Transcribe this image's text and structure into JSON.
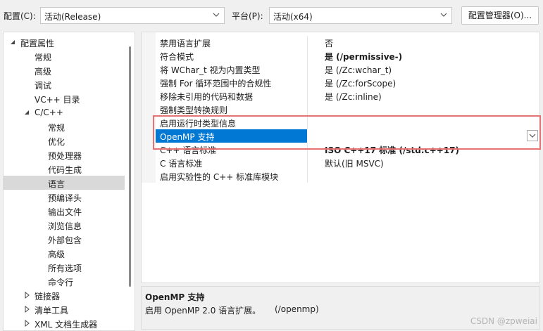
{
  "toolbar": {
    "config_label": "配置(C):",
    "config_value": "活动(Release)",
    "platform_label": "平台(P):",
    "platform_value": "活动(x64)",
    "manager_button": "配置管理器(O)..."
  },
  "tree": {
    "items": [
      {
        "label": "配置属性"
      },
      {
        "label": "常规"
      },
      {
        "label": "高级"
      },
      {
        "label": "调试"
      },
      {
        "label": "VC++ 目录"
      },
      {
        "label": "C/C++"
      },
      {
        "label": "常规"
      },
      {
        "label": "优化"
      },
      {
        "label": "预处理器"
      },
      {
        "label": "代码生成"
      },
      {
        "label": "语言"
      },
      {
        "label": "预编译头"
      },
      {
        "label": "输出文件"
      },
      {
        "label": "浏览信息"
      },
      {
        "label": "外部包含"
      },
      {
        "label": "高级"
      },
      {
        "label": "所有选项"
      },
      {
        "label": "命令行"
      },
      {
        "label": "链接器"
      },
      {
        "label": "清单工具"
      },
      {
        "label": "XML 文档生成器"
      }
    ]
  },
  "properties": [
    {
      "name": "禁用语言扩展",
      "value": "否"
    },
    {
      "name": "符合模式",
      "value": "是 (/permissive-)"
    },
    {
      "name": "将 WChar_t 视为内置类型",
      "value": "是 (/Zc:wchar_t)"
    },
    {
      "name": "强制 For 循环范围中的合规性",
      "value": "是 (/Zc:forScope)"
    },
    {
      "name": "移除未引用的代码和数据",
      "value": "是 (/Zc:inline)"
    },
    {
      "name": "强制类型转换规则",
      "value": ""
    },
    {
      "name": "启用运行时类型信息",
      "value": ""
    },
    {
      "name": "OpenMP 支持",
      "value": ""
    },
    {
      "name": "C++ 语言标准",
      "value": "ISO C++17 标准 (/std:c++17)"
    },
    {
      "name": "C 语言标准",
      "value": "默认(旧 MSVC)"
    },
    {
      "name": "启用实验性的 C++ 标准库模块",
      "value": ""
    }
  ],
  "description": {
    "title": "OpenMP 支持",
    "text": "启用 OpenMP 2.0 语言扩展。",
    "flag": "(/openmp)"
  },
  "watermark": "CSDN @zpweiai",
  "colors": {
    "selection": "#0078d4",
    "highlight_box": "#e57373",
    "tree_selected": "#d9d9d9"
  }
}
